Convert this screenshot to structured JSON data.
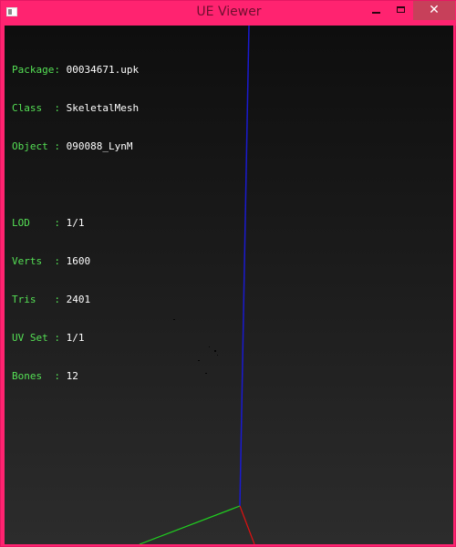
{
  "window": {
    "title": "UE Viewer",
    "controls": {
      "minimize": "",
      "maximize": "",
      "close": "✕"
    }
  },
  "info_panel": {
    "object_info": [
      {
        "label": "Package:",
        "value": "00034671.upk"
      },
      {
        "label": "Class  :",
        "value": "SkeletalMesh"
      },
      {
        "label": "Object :",
        "value": "090088_LynM"
      }
    ],
    "mesh_info": [
      {
        "label": "LOD    :",
        "value": "1/1"
      },
      {
        "label": "Verts  :",
        "value": "1600"
      },
      {
        "label": "Tris   :",
        "value": "2401"
      },
      {
        "label": "UV Set :",
        "value": "1/1"
      },
      {
        "label": "Bones  :",
        "value": "12"
      }
    ]
  },
  "colors": {
    "titlebar": "#ff2370",
    "label_text": "#55e055",
    "value_text": "#ffffff",
    "axis_x": "#e01010",
    "axis_y": "#20d020",
    "axis_z": "#1a1ad0"
  }
}
